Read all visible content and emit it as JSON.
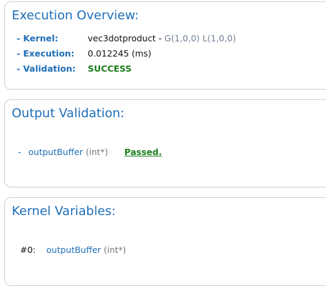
{
  "execution_overview": {
    "title": "Execution Overview:",
    "rows": [
      {
        "label": "- Kernel:",
        "value": "vec3dotproduct - ",
        "extra": "G(1,0,0) L(1,0,0)"
      },
      {
        "label": "- Execution:",
        "value": "0.012245 (ms)"
      },
      {
        "label": "- Validation:",
        "value": "SUCCESS"
      }
    ]
  },
  "output_validation": {
    "title": "Output Validation:",
    "items": [
      {
        "dash": "-",
        "name": "outputBuffer",
        "type": "(int*)",
        "status": "Passed."
      }
    ]
  },
  "kernel_variables": {
    "title": "Kernel Variables:",
    "items": [
      {
        "index": "#0:",
        "name": "outputBuffer",
        "type": "(int*)"
      }
    ]
  },
  "colors": {
    "accent": "#1f6fb7",
    "success": "#1a7d1a",
    "border": "#cfcfcf"
  }
}
